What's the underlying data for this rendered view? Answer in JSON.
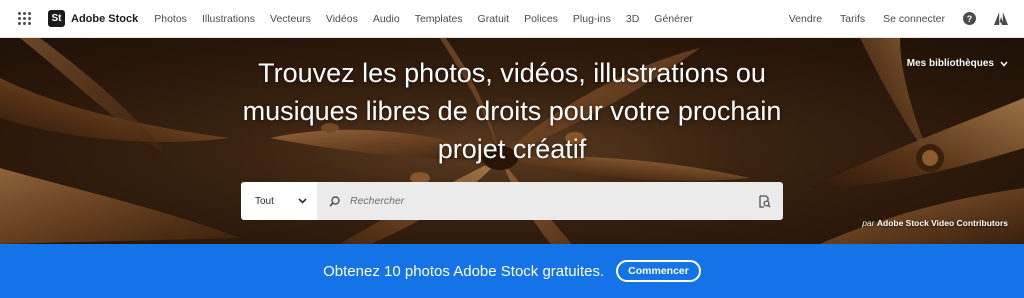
{
  "nav": {
    "brand_badge": "St",
    "brand_name": "Adobe Stock",
    "items": [
      "Photos",
      "Illustrations",
      "Vecteurs",
      "Vidéos",
      "Audio",
      "Templates",
      "Gratuit",
      "Polices",
      "Plug-ins",
      "3D",
      "Générer"
    ],
    "right": {
      "sell": "Vendre",
      "pricing": "Tarifs",
      "signin": "Se connecter"
    }
  },
  "hero": {
    "headline": "Trouvez les photos, vidéos, illustrations ou musiques libres de droits pour votre prochain projet créatif",
    "libraries": "Mes bibliothèques",
    "search": {
      "scope": "Tout",
      "placeholder": "Rechercher"
    },
    "credit": {
      "prefix": "par",
      "author": "Adobe Stock Video Contributors"
    }
  },
  "promo": {
    "text": "Obtenez 10 photos Adobe Stock gratuites.",
    "button": "Commencer"
  },
  "colors": {
    "promo_blue": "#1473e6",
    "nav_text": "#4b4b4b",
    "brand_dark": "#1a1a1a"
  },
  "icons": [
    "app-switcher-icon",
    "help-icon",
    "adobe-logo-icon",
    "chevron-down-icon",
    "search-icon",
    "visual-search-icon"
  ]
}
